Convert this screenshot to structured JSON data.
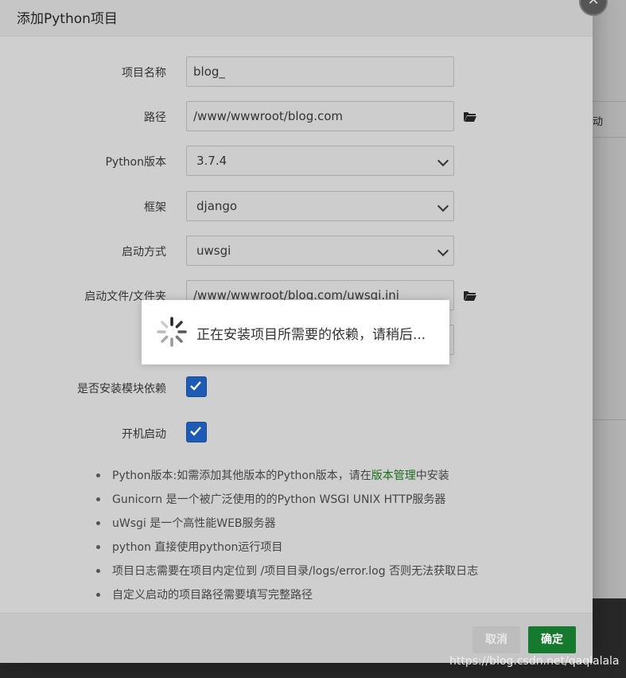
{
  "dialog": {
    "title": "添加Python项目",
    "close_glyph": "✕",
    "form": {
      "project_name": {
        "label": "项目名称",
        "value": "blog_"
      },
      "path": {
        "label": "路径",
        "value": "/www/wwwroot/blog.com"
      },
      "python_version": {
        "label": "Python版本",
        "value": "3.7.4"
      },
      "framework": {
        "label": "框架",
        "value": "django"
      },
      "startup_method": {
        "label": "启动方式",
        "value": "uwsgi"
      },
      "startup_file": {
        "label": "启动文件/文件夹",
        "value": "/www/wwwroot/blog.com/uwsgi.ini"
      },
      "install_deps": {
        "label": "是否安装模块依赖",
        "checked": true
      },
      "auto_start": {
        "label": "开机启动",
        "checked": true
      }
    },
    "notes": {
      "n1_prefix": "Python版本:如需添加其他版本的Python版本，请在",
      "n1_link": "版本管理",
      "n1_suffix": "中安装",
      "n2": "Gunicorn 是一个被广泛使用的的Python WSGI UNIX HTTP服务器",
      "n3": "uWsgi 是一个高性能WEB服务器",
      "n4": "python 直接使用python运行项目",
      "n5": "项目日志需要在项目内定位到 /项目目录/logs/error.log 否则无法获取日志",
      "n6": "自定义启动的项目路径需要填写完整路径"
    },
    "buttons": {
      "cancel": "取消",
      "confirm": "确定"
    }
  },
  "loading": {
    "message": "正在安装项目所需要的依赖，请稍后..."
  },
  "background": {
    "side_text": "动"
  },
  "watermark": "https://blog.csdn.net/qaqlalala",
  "colors": {
    "confirm_button": "#157a2d",
    "checkbox": "#1e5bb5",
    "link": "#1b6d1b"
  },
  "icons": [
    "folder-icon",
    "chevron-down-icon",
    "checkmark-icon",
    "spinner-icon",
    "close-icon"
  ]
}
